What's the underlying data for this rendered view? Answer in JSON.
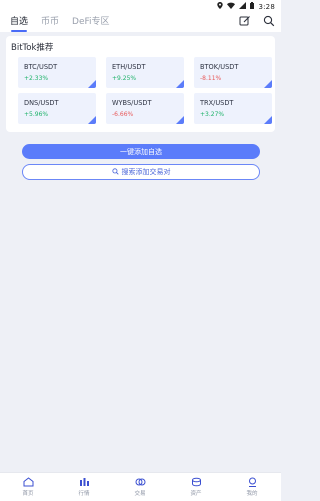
{
  "status_bar": {
    "time": "3:28"
  },
  "header": {
    "tabs": [
      {
        "label": "自选",
        "active": true
      },
      {
        "label": "币币",
        "active": false
      },
      {
        "label": "DeFi专区",
        "active": false
      }
    ],
    "icons": [
      "edit-icon",
      "search-icon"
    ]
  },
  "recommend": {
    "title": "BitTok推荐",
    "items": [
      {
        "pair": "BTC/USDT",
        "change": "+2.33%",
        "color": "#21b36b"
      },
      {
        "pair": "ETH/USDT",
        "change": "+9.25%",
        "color": "#21b36b"
      },
      {
        "pair": "BTOK/USDT",
        "change": "-8.11%",
        "color": "#e85a5a"
      },
      {
        "pair": "DNS/USDT",
        "change": "+5.96%",
        "color": "#21b36b"
      },
      {
        "pair": "WYBS/USDT",
        "change": "-6.66%",
        "color": "#e85a5a"
      },
      {
        "pair": "TRX/USDT",
        "change": "+3.27%",
        "color": "#21b36b"
      }
    ]
  },
  "actions": {
    "add_all": "一键添加自选",
    "search_pairs": "搜索添加交易对"
  },
  "bottom_nav": [
    {
      "label": "首页",
      "icon": "home-icon"
    },
    {
      "label": "行情",
      "icon": "market-chart-icon"
    },
    {
      "label": "交易",
      "icon": "trade-icon"
    },
    {
      "label": "资产",
      "icon": "assets-icon"
    },
    {
      "label": "我的",
      "icon": "profile-icon"
    }
  ],
  "colors": {
    "accent": "#5b7cfa",
    "up": "#21b36b",
    "down": "#e85a5a"
  }
}
